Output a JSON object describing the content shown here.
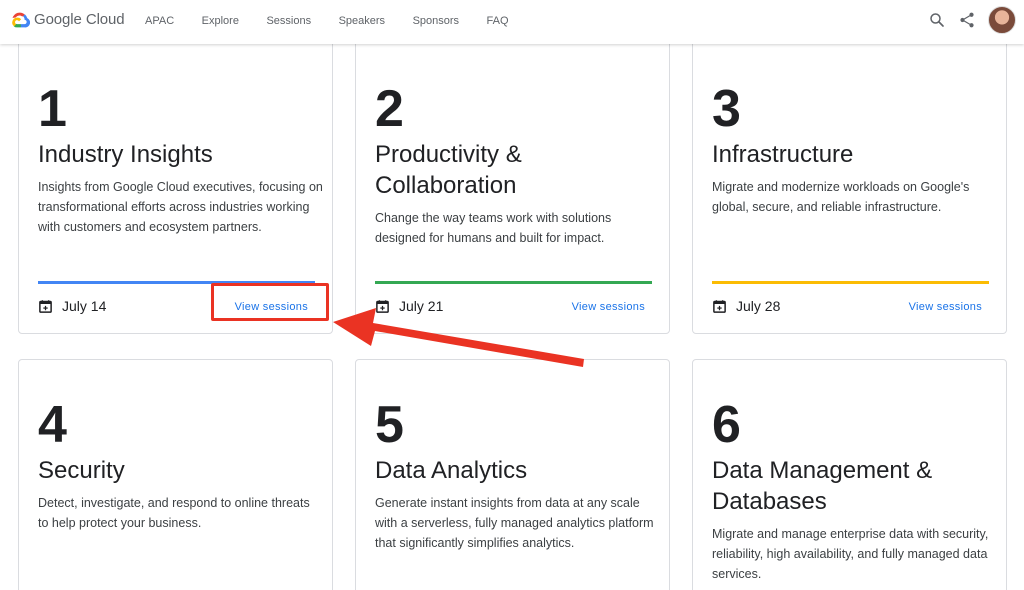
{
  "header": {
    "brand": "Google Cloud",
    "nav": [
      "APAC",
      "Explore",
      "Sessions",
      "Speakers",
      "Sponsors",
      "FAQ"
    ],
    "icons": [
      "search-icon",
      "share-icon",
      "avatar"
    ]
  },
  "cards": [
    {
      "number": "1",
      "title": "Industry Insights",
      "description": "Insights from Google Cloud executives, focusing on transformational efforts across industries working with customers and ecosystem partners.",
      "date": "July 14",
      "link": "View sessions",
      "accent": "#4285f4"
    },
    {
      "number": "2",
      "title": "Productivity & Collaboration",
      "description": "Change the way teams work with solutions designed for humans and built for impact.",
      "date": "July 21",
      "link": "View sessions",
      "accent": "#34a853"
    },
    {
      "number": "3",
      "title": "Infrastructure",
      "description": "Migrate and modernize workloads on Google's global, secure, and reliable infrastructure.",
      "date": "July 28",
      "link": "View sessions",
      "accent": "#fbbc04"
    },
    {
      "number": "4",
      "title": "Security",
      "description": "Detect, investigate, and respond to online threats to help protect your business."
    },
    {
      "number": "5",
      "title": "Data Analytics",
      "description": "Generate instant insights from data at any scale with a serverless, fully managed analytics platform that significantly simplifies analytics."
    },
    {
      "number": "6",
      "title": "Data Management & Databases",
      "description": "Migrate and manage enterprise data with security, reliability, high availability, and fully managed data services."
    }
  ],
  "annotation": {
    "color": "#ea3323"
  }
}
